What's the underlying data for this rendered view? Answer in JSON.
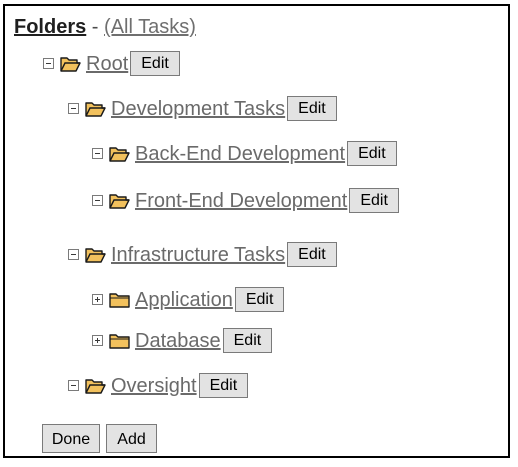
{
  "header": {
    "title": "Folders",
    "separator": " - ",
    "all_tasks_link": "(All Tasks)"
  },
  "tree": [
    {
      "label": "Root",
      "toggle": "collapse",
      "folder_state": "open",
      "edit_label": "Edit"
    },
    {
      "label": "Development Tasks",
      "toggle": "collapse",
      "folder_state": "open",
      "edit_label": "Edit"
    },
    {
      "label": "Back-End Development",
      "toggle": "collapse",
      "folder_state": "open",
      "edit_label": "Edit"
    },
    {
      "label": "Front-End Development",
      "toggle": "collapse",
      "folder_state": "open",
      "edit_label": "Edit"
    },
    {
      "label": "Infrastructure Tasks",
      "toggle": "collapse",
      "folder_state": "open",
      "edit_label": "Edit"
    },
    {
      "label": "Application",
      "toggle": "expand",
      "folder_state": "closed",
      "edit_label": "Edit"
    },
    {
      "label": "Database",
      "toggle": "expand",
      "folder_state": "closed",
      "edit_label": "Edit"
    },
    {
      "label": "Oversight",
      "toggle": "collapse",
      "folder_state": "open",
      "edit_label": "Edit"
    }
  ],
  "footer": {
    "done_label": "Done",
    "add_label": "Add"
  },
  "colors": {
    "folder_fill": "#f2c15d",
    "folder_stroke": "#1a1a1a",
    "button_bg": "#e3e3e3"
  }
}
